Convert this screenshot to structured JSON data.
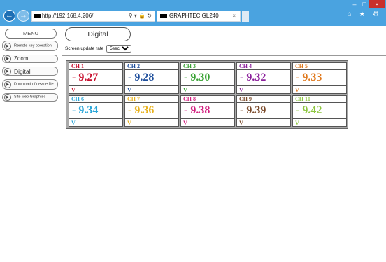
{
  "browser": {
    "url": "http://192.168.4.206/",
    "address_controls": "⚲ ▾ 🔒 ↻",
    "tab_title": "GRAPHTEC GL240",
    "tab_close": "×",
    "back_icon": "←",
    "forward_icon": "→",
    "minimize": "–",
    "maximize": "□",
    "close": "×",
    "toolbar_icons": "⌂ ★ ⚙"
  },
  "sidebar": {
    "menu_label": "MENU",
    "items": [
      {
        "label": "Remote key operation",
        "small": true
      },
      {
        "label": "Zoom",
        "small": false
      },
      {
        "label": "Digital",
        "small": false
      },
      {
        "label": "Download of device file",
        "small": true
      },
      {
        "label": "Site web Graphtec",
        "small": true
      }
    ]
  },
  "main": {
    "title": "Digital",
    "rate_label": "Screen update rate",
    "rate_value": "5sec",
    "channels": [
      {
        "ch": "CH 1",
        "value": "- 9.27",
        "unit": "V",
        "color": "#c8102e"
      },
      {
        "ch": "CH 2",
        "value": "- 9.28",
        "unit": "V",
        "color": "#1f4f9c"
      },
      {
        "ch": "CH 3",
        "value": "- 9.30",
        "unit": "V",
        "color": "#3aa335"
      },
      {
        "ch": "CH 4",
        "value": "- 9.32",
        "unit": "V",
        "color": "#8b1f9b"
      },
      {
        "ch": "CH 5",
        "value": "- 9.33",
        "unit": "V",
        "color": "#e07a1f"
      },
      {
        "ch": "CH 6",
        "value": "- 9.34",
        "unit": "V",
        "color": "#2ba6d8"
      },
      {
        "ch": "CH 7",
        "value": "- 9.36",
        "unit": "V",
        "color": "#e8b21f"
      },
      {
        "ch": "CH 8",
        "value": "- 9.38",
        "unit": "V",
        "color": "#d21f7f"
      },
      {
        "ch": "CH 9",
        "value": "- 9.39",
        "unit": "V",
        "color": "#7a4a2a"
      },
      {
        "ch": "CH 10",
        "value": "- 9.42",
        "unit": "V",
        "color": "#8dc63f"
      }
    ]
  }
}
